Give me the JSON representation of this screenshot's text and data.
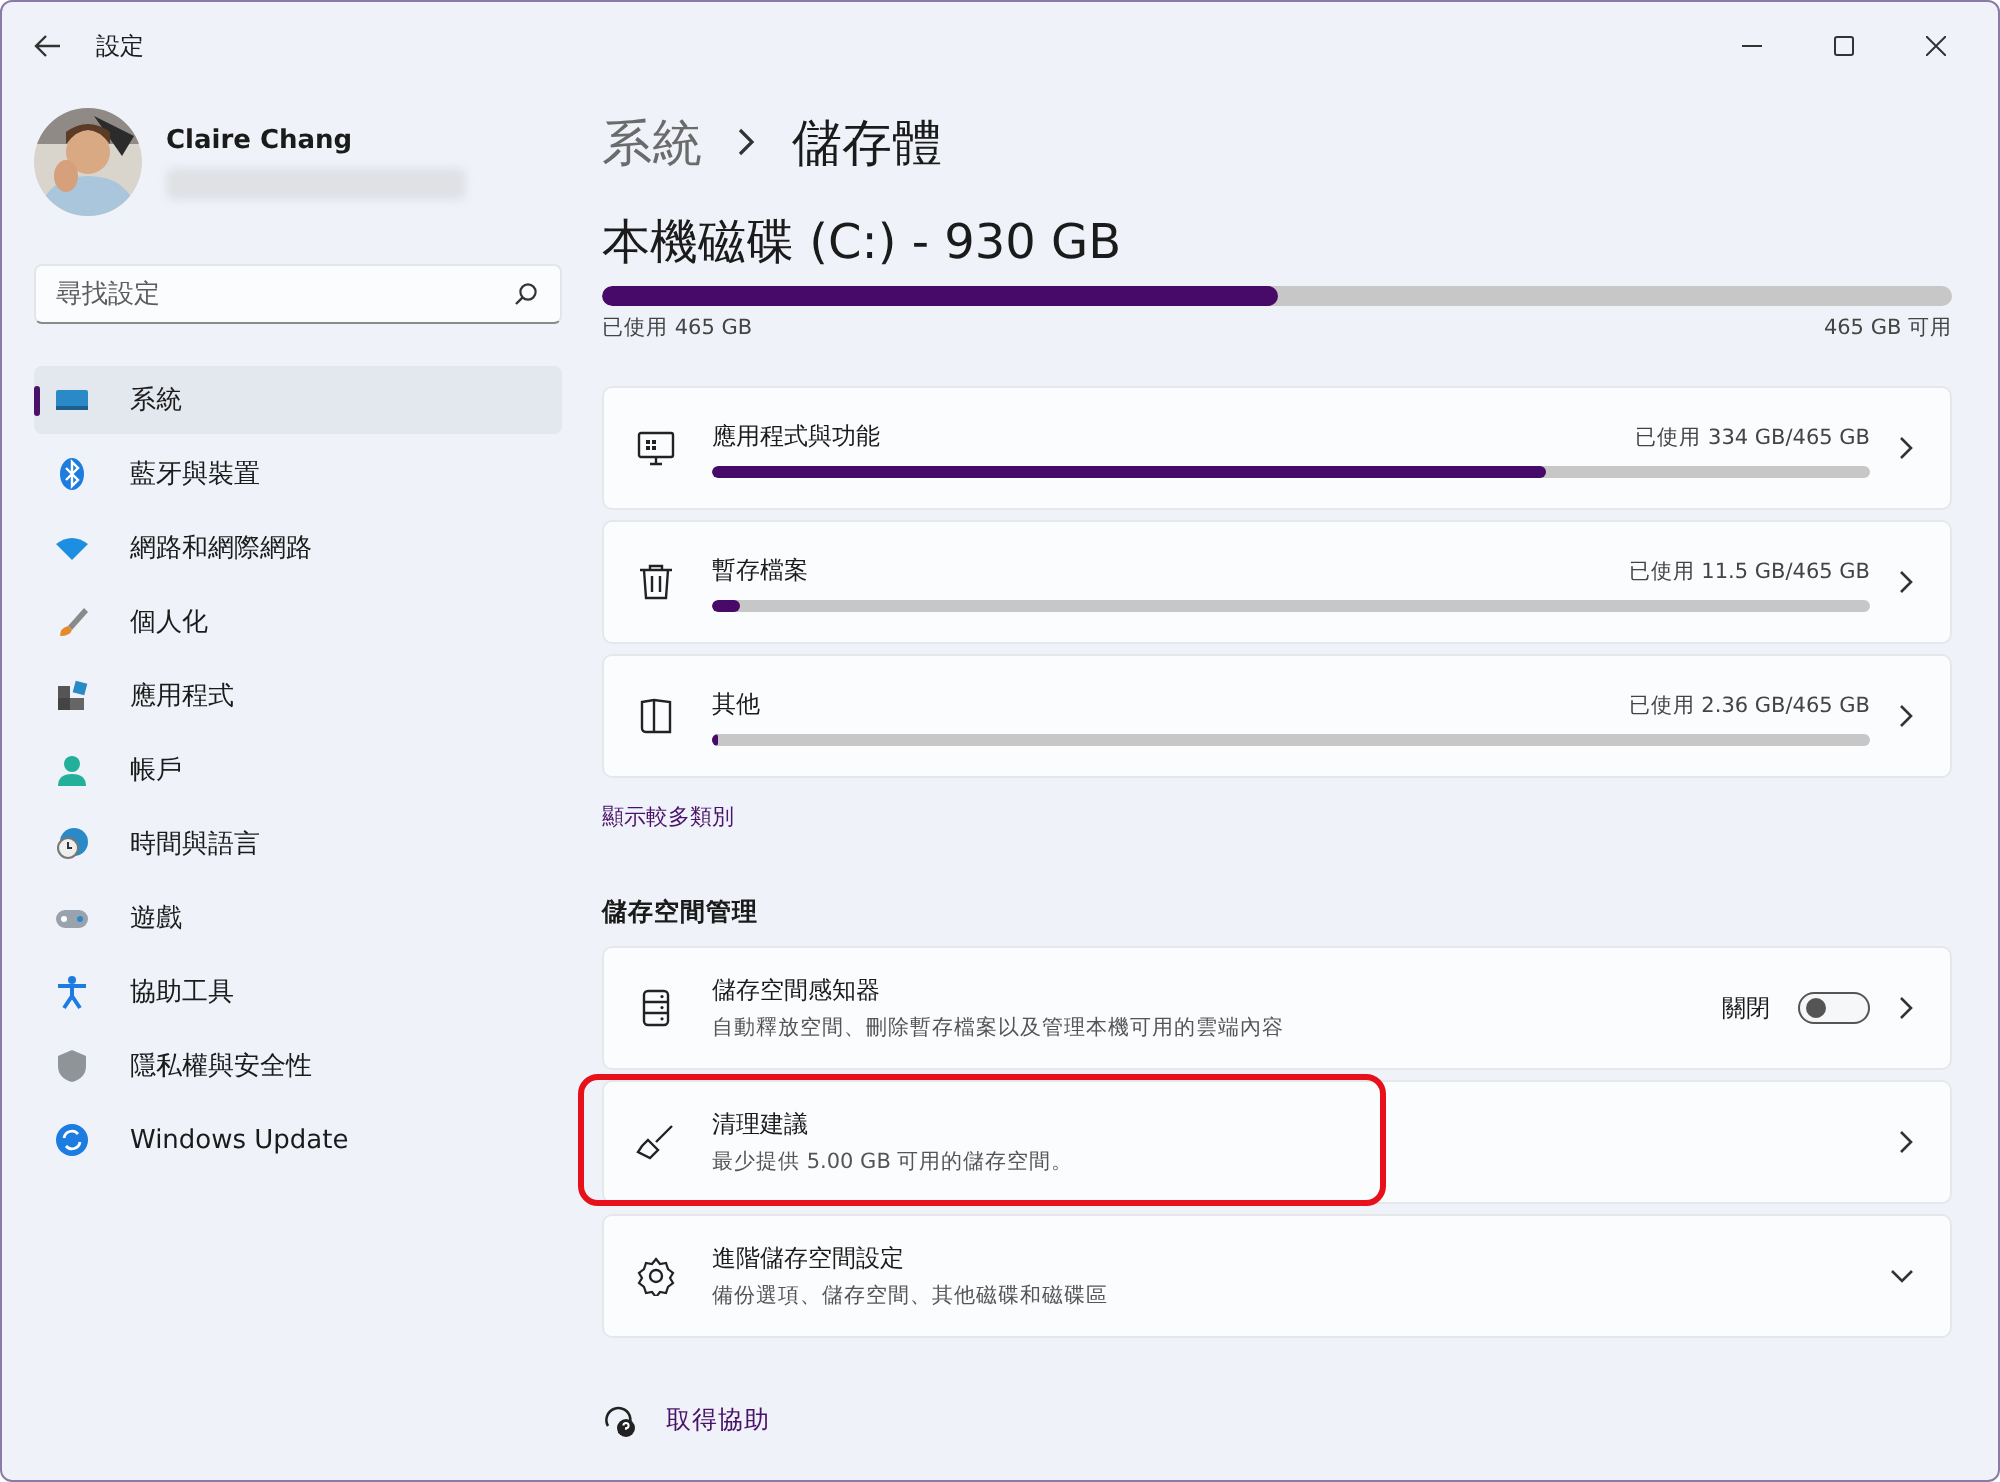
{
  "window": {
    "title": "設定"
  },
  "user": {
    "name": "Claire Chang"
  },
  "search": {
    "placeholder": "尋找設定"
  },
  "nav": [
    {
      "label": "系統",
      "selected": true
    },
    {
      "label": "藍牙與裝置",
      "selected": false
    },
    {
      "label": "網路和網際網路",
      "selected": false
    },
    {
      "label": "個人化",
      "selected": false
    },
    {
      "label": "應用程式",
      "selected": false
    },
    {
      "label": "帳戶",
      "selected": false
    },
    {
      "label": "時間與語言",
      "selected": false
    },
    {
      "label": "遊戲",
      "selected": false
    },
    {
      "label": "協助工具",
      "selected": false
    },
    {
      "label": "隱私權與安全性",
      "selected": false
    },
    {
      "label": "Windows Update",
      "selected": false
    }
  ],
  "breadcrumb": {
    "parent": "系統",
    "current": "儲存體"
  },
  "drive": {
    "title": "本機磁碟 (C:) - 930 GB",
    "level": 0.5,
    "used": "已使用 465 GB",
    "free": "465 GB 可用"
  },
  "categories": [
    {
      "name": "應用程式與功能",
      "usage": "已使用 334 GB/465 GB",
      "level": 0.72
    },
    {
      "name": "暫存檔案",
      "usage": "已使用 11.5 GB/465 GB",
      "level": 0.025
    },
    {
      "name": "其他",
      "usage": "已使用 2.36 GB/465 GB",
      "level": 0.005
    }
  ],
  "more_link": "顯示較多類別",
  "management": {
    "heading": "儲存空間管理",
    "items": [
      {
        "kind": "toggle",
        "title": "儲存空間感知器",
        "description": "自動釋放空間、刪除暫存檔案以及管理本機可用的雲端內容",
        "state_label": "關閉",
        "on": false,
        "highlighted": false
      },
      {
        "kind": "link",
        "title": "清理建議",
        "description": "最少提供 5.00 GB 可用的儲存空間。",
        "highlighted": true
      },
      {
        "kind": "expand",
        "title": "進階儲存空間設定",
        "description": "備份選項、儲存空間、其他磁碟和磁碟區",
        "highlighted": false
      }
    ]
  },
  "help_link": "取得協助"
}
